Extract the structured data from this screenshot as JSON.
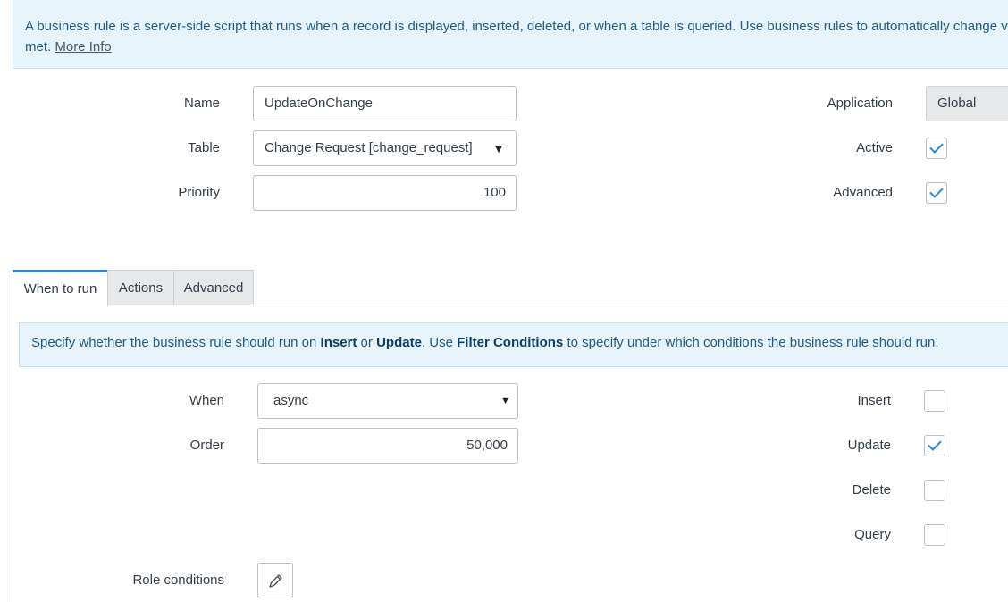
{
  "info": {
    "text_line1": "A business rule is a server-side script that runs when a record is displayed, inserted, deleted, or when a table is queried. Use business rules to automatically change v",
    "text_line2": "met.",
    "more_info": "More Info"
  },
  "form": {
    "name": {
      "label": "Name",
      "value": "UpdateOnChange"
    },
    "table": {
      "label": "Table",
      "value": "Change Request [change_request]"
    },
    "priority": {
      "label": "Priority",
      "value": "100"
    },
    "application": {
      "label": "Application",
      "value": "Global"
    },
    "active": {
      "label": "Active",
      "checked": true
    },
    "advanced": {
      "label": "Advanced",
      "checked": true
    }
  },
  "tabs": [
    {
      "label": "When to run",
      "active": true
    },
    {
      "label": "Actions",
      "active": false
    },
    {
      "label": "Advanced",
      "active": false
    }
  ],
  "tab_info": {
    "pre": "Specify whether the business rule should run on ",
    "insert": "Insert",
    "or": " or ",
    "update": "Update",
    "mid": ". Use ",
    "filter": "Filter Conditions",
    "post": " to specify under which conditions the business rule should run."
  },
  "when_to_run": {
    "when": {
      "label": "When",
      "value": "async"
    },
    "order": {
      "label": "Order",
      "value": "50,000"
    },
    "insert": {
      "label": "Insert",
      "checked": false
    },
    "update": {
      "label": "Update",
      "checked": true
    },
    "delete": {
      "label": "Delete",
      "checked": false
    },
    "query": {
      "label": "Query",
      "checked": false
    },
    "role_conditions": {
      "label": "Role conditions"
    }
  },
  "icons": {
    "dropdown": "caret-down-icon",
    "edit": "pencil-icon",
    "check": "checkmark-icon"
  },
  "colors": {
    "accent": "#2b87d3",
    "info_bg": "#e8f4fc",
    "info_text": "#1f5c87"
  }
}
